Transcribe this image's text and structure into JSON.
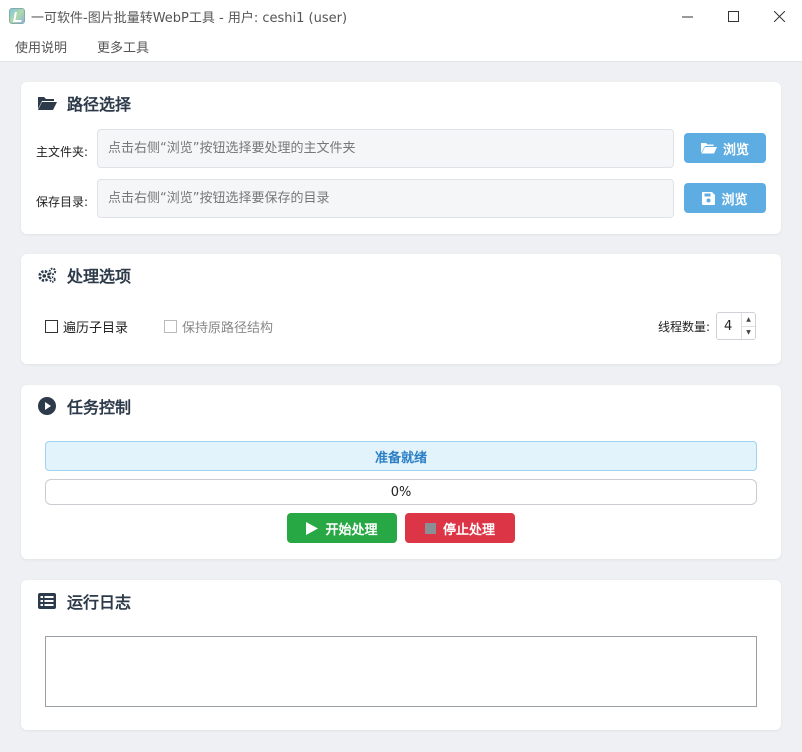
{
  "window": {
    "title": "一可软件-图片批量转WebP工具 - 用户: ceshi1 (user)",
    "minimize": "—",
    "maximize": "☐",
    "close": "✕"
  },
  "menu": [
    "使用说明",
    "更多工具"
  ],
  "path_section": {
    "title": "路径选择",
    "main_folder_label": "主文件夹:",
    "main_folder_value": "",
    "main_folder_placeholder": "点击右侧“浏览”按钮选择要处理的主文件夹",
    "save_dir_label": "保存目录:",
    "save_dir_value": "",
    "save_dir_placeholder": "点击右侧“浏览”按钮选择要保存的目录",
    "browse_label": "浏览"
  },
  "options_section": {
    "title": "处理选项",
    "recursive_label": "遍历子目录",
    "recursive_checked": false,
    "keep_structure_label": "保持原路径结构",
    "keep_structure_checked": false,
    "thread_label": "线程数量:",
    "thread_count": "4"
  },
  "task_section": {
    "title": "任务控制",
    "status": "准备就绪",
    "progress": 0,
    "progress_text": "0%",
    "start_label": "开始处理",
    "stop_label": "停止处理"
  },
  "log_section": {
    "title": "运行日志",
    "log_text": ""
  },
  "colors": {
    "accent_blue": "#5dade2",
    "start_green": "#28a745",
    "stop_red": "#dc3545",
    "status_text": "#2b7fc4"
  }
}
